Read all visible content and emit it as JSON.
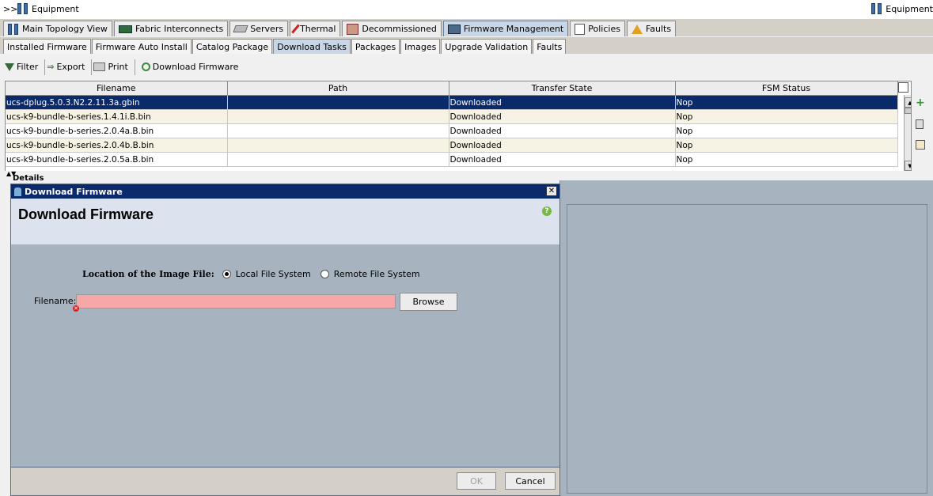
{
  "breadcrumb": {
    "prefix": ">>",
    "left": "Equipment",
    "right": "Equipment"
  },
  "main_tabs": [
    {
      "label": "Main Topology View",
      "icon": "topology-icon"
    },
    {
      "label": "Fabric Interconnects",
      "icon": "fabric-interconnect-icon"
    },
    {
      "label": "Servers",
      "icon": "server-icon"
    },
    {
      "label": "Thermal",
      "icon": "thermal-icon"
    },
    {
      "label": "Decommissioned",
      "icon": "decommissioned-icon"
    },
    {
      "label": "Firmware Management",
      "icon": "firmware-icon"
    },
    {
      "label": "Policies",
      "icon": "policies-icon"
    },
    {
      "label": "Faults",
      "icon": "faults-icon"
    }
  ],
  "sub_tabs": [
    "Installed Firmware",
    "Firmware Auto Install",
    "Catalog Package",
    "Download Tasks",
    "Packages",
    "Images",
    "Upgrade Validation",
    "Faults"
  ],
  "toolbar": {
    "filter": "Filter",
    "export": "Export",
    "print": "Print",
    "download": "Download Firmware"
  },
  "table": {
    "columns": [
      "Filename",
      "Path",
      "Transfer State",
      "FSM Status"
    ],
    "rows": [
      {
        "filename": "ucs-dplug.5.0.3.N2.2.11.3a.gbin",
        "path": "",
        "state": "Downloaded",
        "fsm": "Nop"
      },
      {
        "filename": "ucs-k9-bundle-b-series.1.4.1i.B.bin",
        "path": "",
        "state": "Downloaded",
        "fsm": "Nop"
      },
      {
        "filename": "ucs-k9-bundle-b-series.2.0.4a.B.bin",
        "path": "",
        "state": "Downloaded",
        "fsm": "Nop"
      },
      {
        "filename": "ucs-k9-bundle-b-series.2.0.4b.B.bin",
        "path": "",
        "state": "Downloaded",
        "fsm": "Nop"
      },
      {
        "filename": "ucs-k9-bundle-b-series.2.0.5a.B.bin",
        "path": "",
        "state": "Downloaded",
        "fsm": "Nop"
      }
    ]
  },
  "details_label": "Details",
  "dialog": {
    "title": "Download Firmware",
    "heading": "Download Firmware",
    "location_label": "Location of the Image File:",
    "option_local": "Local File System",
    "option_remote": "Remote File System",
    "filename_label": "Filename:",
    "filename_value": "",
    "browse": "Browse",
    "ok": "OK",
    "cancel": "Cancel"
  },
  "colors": {
    "selection": "#0b2a6b",
    "dialog_bg": "#a8b3c0",
    "invalid_field": "#f6a8a8"
  }
}
